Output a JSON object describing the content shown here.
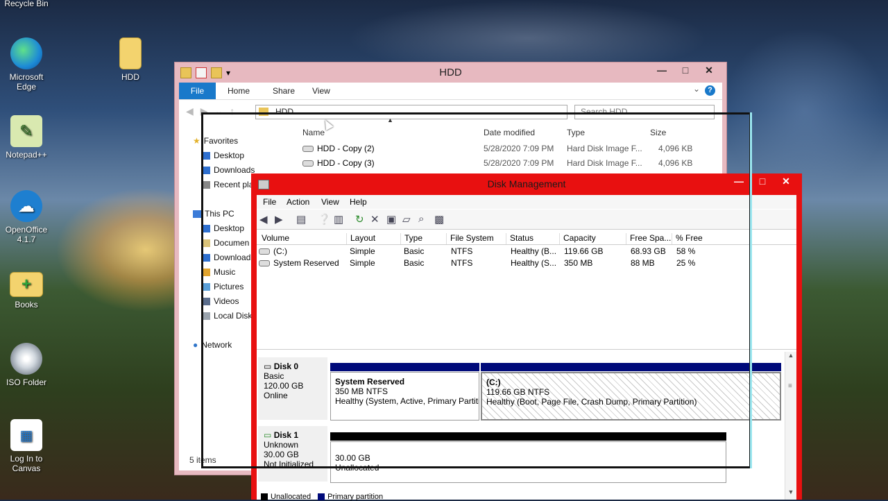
{
  "desktop": {
    "icons": [
      {
        "label": "Recycle Bin",
        "icon": "recycle-bin-icon"
      },
      {
        "label": "Microsoft Edge",
        "icon": "edge-icon"
      },
      {
        "label": "HDD",
        "icon": "folder-icon"
      },
      {
        "label": "Notepad++",
        "icon": "notepad-icon"
      },
      {
        "label": "OpenOffice 4.1.7",
        "icon": "openoffice-icon"
      },
      {
        "label": "Books",
        "icon": "folder-icon"
      },
      {
        "label": "ISO Folder",
        "icon": "disc-icon"
      },
      {
        "label": "Log In to Canvas",
        "icon": "canvas-icon"
      }
    ]
  },
  "explorer": {
    "title": "HDD",
    "ribbon_tabs": [
      "File",
      "Home",
      "Share",
      "View"
    ],
    "address": "HDD",
    "search_placeholder": "Search HDD",
    "nav": {
      "favorites": "Favorites",
      "fav_items": [
        "Desktop",
        "Downloads",
        "Recent pla"
      ],
      "this_pc": "This PC",
      "pc_items": [
        "Desktop",
        "Documen",
        "Download",
        "Music",
        "Pictures",
        "Videos",
        "Local Disk"
      ],
      "network": "Network"
    },
    "columns": [
      "Name",
      "Date modified",
      "Type",
      "Size"
    ],
    "files": [
      {
        "name": "HDD - Copy (2)",
        "date": "5/28/2020 7:09 PM",
        "type": "Hard Disk Image F...",
        "size": "4,096 KB"
      },
      {
        "name": "HDD - Copy (3)",
        "date": "5/28/2020 7:09 PM",
        "type": "Hard Disk Image F...",
        "size": "4,096 KB"
      }
    ],
    "status": "5 items"
  },
  "diskmgmt": {
    "title": "Disk Management",
    "menu": [
      "File",
      "Action",
      "View",
      "Help"
    ],
    "columns": [
      "Volume",
      "Layout",
      "Type",
      "File System",
      "Status",
      "Capacity",
      "Free Spa...",
      "% Free"
    ],
    "volumes": [
      {
        "volume": "(C:)",
        "layout": "Simple",
        "type": "Basic",
        "fs": "NTFS",
        "status": "Healthy (B...",
        "capacity": "119.66 GB",
        "free": "68.93 GB",
        "pct": "58 %"
      },
      {
        "volume": "System Reserved",
        "layout": "Simple",
        "type": "Basic",
        "fs": "NTFS",
        "status": "Healthy (S...",
        "capacity": "350 MB",
        "free": "88 MB",
        "pct": "25 %"
      }
    ],
    "disk0": {
      "name": "Disk 0",
      "kind": "Basic",
      "size": "120.00 GB",
      "state": "Online",
      "p1": {
        "name": "System Reserved",
        "size": "350 MB NTFS",
        "status": "Healthy (System, Active, Primary Partiti"
      },
      "p2": {
        "name": "(C:)",
        "size": "119.66 GB NTFS",
        "status": "Healthy (Boot, Page File, Crash Dump, Primary Partition)"
      }
    },
    "disk1": {
      "name": "Disk 1",
      "kind": "Unknown",
      "size": "30.00 GB",
      "state": "Not Initialized",
      "p1": {
        "size": "30.00 GB",
        "status": "Unallocated"
      }
    },
    "legend": [
      "Unallocated",
      "Primary partition"
    ],
    "colors": {
      "primary": "#000a7a",
      "unallocated": "#000000",
      "frame": "#e81010"
    }
  }
}
